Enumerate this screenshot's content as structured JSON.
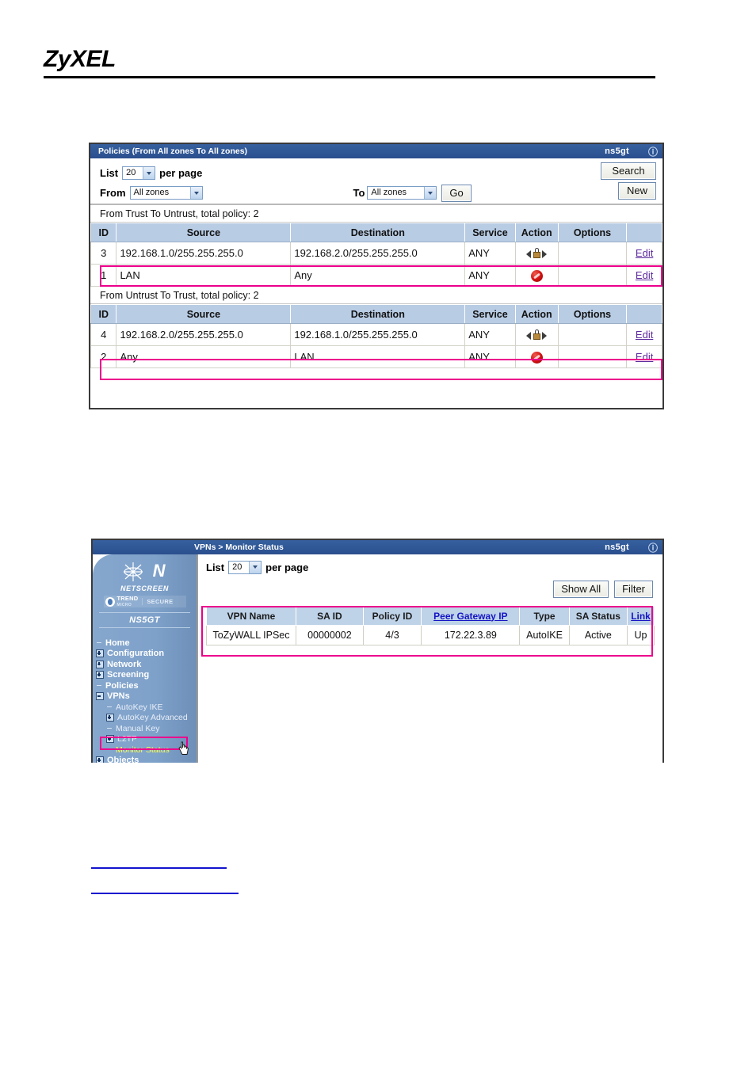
{
  "page": {
    "brand": "ZyXEL"
  },
  "policies_window": {
    "title": "Policies (From All zones To All zones)",
    "device": "ns5gt",
    "help_icon": "help-icon",
    "toolbar": {
      "list_label": "List",
      "list_value": "20",
      "per_page_label": "per page",
      "from_label": "From",
      "from_value": "All zones",
      "to_label": "To",
      "to_value": "All zones",
      "go_label": "Go",
      "search_label": "Search",
      "new_label": "New"
    },
    "columns": [
      "ID",
      "Source",
      "Destination",
      "Service",
      "Action",
      "Options",
      ""
    ],
    "sections": [
      {
        "caption": "From Trust To Untrust, total policy: 2",
        "rows": [
          {
            "id": "3",
            "source": "192.168.1.0/255.255.255.0",
            "destination": "192.168.2.0/255.255.255.0",
            "service": "ANY",
            "action": "tunnel-icon",
            "options": "",
            "edit": "Edit",
            "highlighted": true
          },
          {
            "id": "1",
            "source": "LAN",
            "destination": "Any",
            "service": "ANY",
            "action": "deny-icon",
            "options": "",
            "edit": "Edit",
            "highlighted": false
          }
        ]
      },
      {
        "caption": "From Untrust To Trust, total policy: 2",
        "rows": [
          {
            "id": "4",
            "source": "192.168.2.0/255.255.255.0",
            "destination": "192.168.1.0/255.255.255.0",
            "service": "ANY",
            "action": "tunnel-icon",
            "options": "",
            "edit": "Edit",
            "highlighted": true
          },
          {
            "id": "2",
            "source": "Any",
            "destination": "LAN",
            "service": "ANY",
            "action": "deny-icon",
            "options": "",
            "edit": "Edit",
            "highlighted": false
          }
        ]
      }
    ]
  },
  "vpn_window": {
    "title": "VPNs > Monitor Status",
    "device": "ns5gt",
    "help_icon": "help-icon",
    "sidebar": {
      "wordmark": "NETSCREEN",
      "trend_name": "TREND",
      "trend_sub": "MICRO",
      "trend_secure": "SECURE",
      "model": "NS5GT",
      "items": [
        {
          "label": "Home",
          "level": 0,
          "toggle": "dash",
          "selected": false
        },
        {
          "label": "Configuration",
          "level": 0,
          "toggle": "plus",
          "selected": false
        },
        {
          "label": "Network",
          "level": 0,
          "toggle": "plus",
          "selected": false
        },
        {
          "label": "Screening",
          "level": 0,
          "toggle": "plus",
          "selected": false
        },
        {
          "label": "Policies",
          "level": 0,
          "toggle": "dash",
          "selected": false
        },
        {
          "label": "VPNs",
          "level": 0,
          "toggle": "minus",
          "selected": false
        },
        {
          "label": "AutoKey IKE",
          "level": 1,
          "toggle": "dash",
          "selected": false
        },
        {
          "label": "AutoKey Advanced",
          "level": 1,
          "toggle": "plus",
          "selected": false
        },
        {
          "label": "Manual Key",
          "level": 1,
          "toggle": "dash",
          "selected": false
        },
        {
          "label": "L2TP",
          "level": 1,
          "toggle": "plus",
          "selected": false
        },
        {
          "label": "Monitor Status",
          "level": 1,
          "toggle": "dash",
          "selected": true
        },
        {
          "label": "Objects",
          "level": 0,
          "toggle": "plus",
          "selected": false
        }
      ]
    },
    "toolbar": {
      "list_label": "List",
      "list_value": "20",
      "per_page_label": "per page",
      "show_all_label": "Show All",
      "filter_label": "Filter"
    },
    "table": {
      "columns": [
        "VPN Name",
        "SA ID",
        "Policy ID",
        "Peer Gateway IP",
        "Type",
        "SA Status",
        "Link"
      ],
      "link_columns": [
        "Peer Gateway IP",
        "Link"
      ],
      "rows": [
        {
          "vpn_name": "ToZyWALL IPSec",
          "sa_id": "00000002",
          "policy_id": "4/3",
          "peer_gateway_ip": "172.22.3.89",
          "type": "AutoIKE",
          "sa_status": "Active",
          "link": "Up"
        }
      ]
    }
  },
  "colors": {
    "titlebar": "#2e5596",
    "table_header": "#b8cce4",
    "highlight": "#ec008c",
    "sidebar": "#7ea1ca",
    "link": "#1515c4",
    "visited_link": "#5c2a9d",
    "selected_nav": "#ffff4d"
  },
  "bottom_links": [
    {
      "label": ""
    },
    {
      "label": ""
    }
  ]
}
